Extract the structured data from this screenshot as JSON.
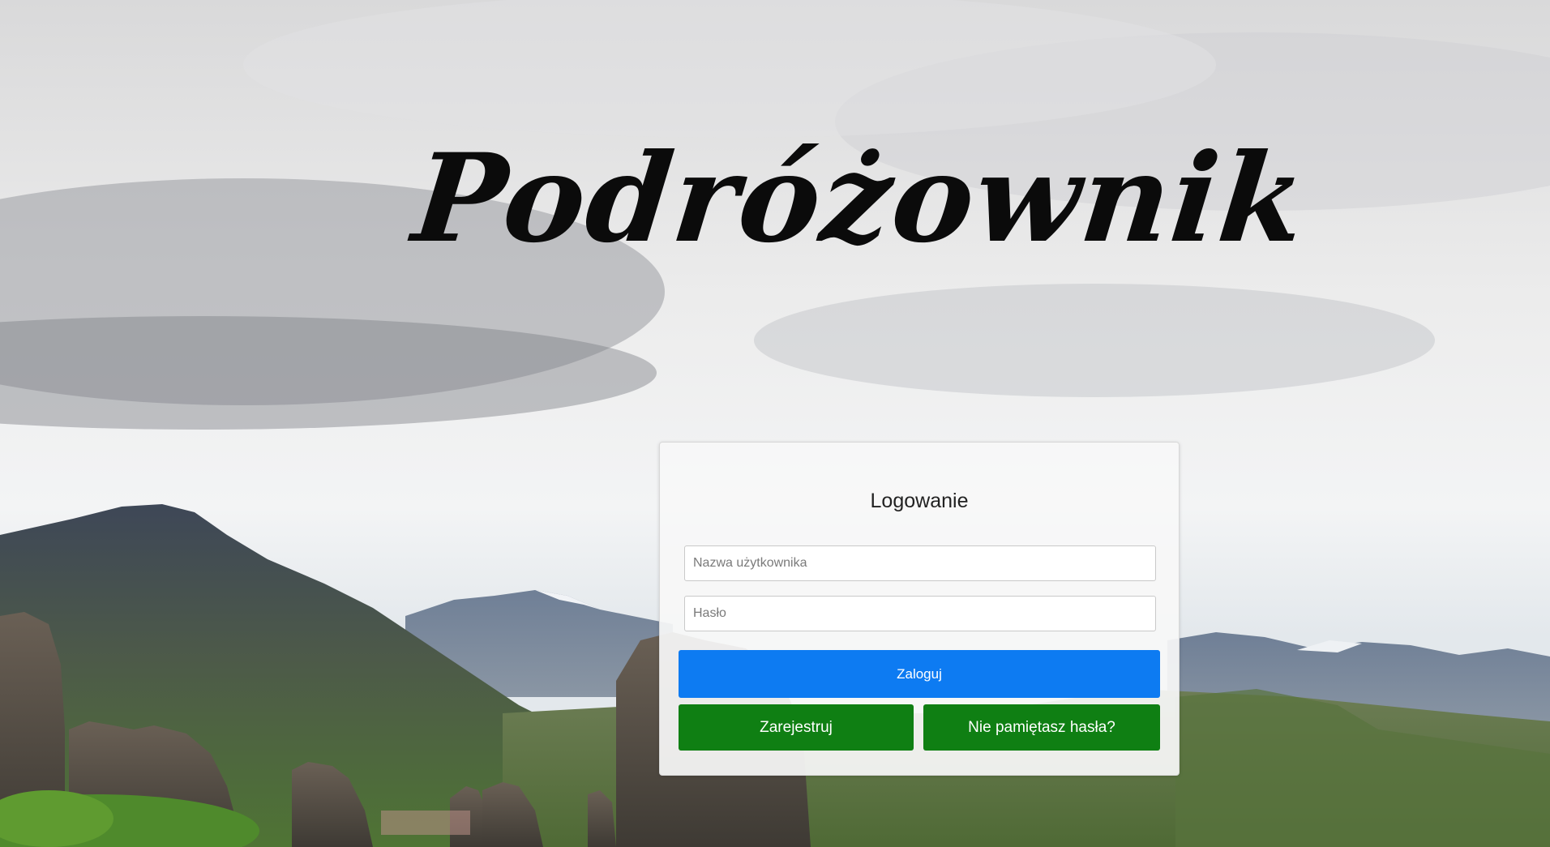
{
  "app": {
    "brand": "Podróżownik"
  },
  "login": {
    "heading": "Logowanie",
    "username_placeholder": "Nazwa użytkownika",
    "password_placeholder": "Hasło",
    "login_label": "Zaloguj",
    "register_label": "Zarejestruj",
    "forgot_label": "Nie pamiętasz hasła?"
  },
  "colors": {
    "primary": "#0d7bf2",
    "success": "#0f7f13",
    "panel_bg": "#f8f8f8"
  }
}
